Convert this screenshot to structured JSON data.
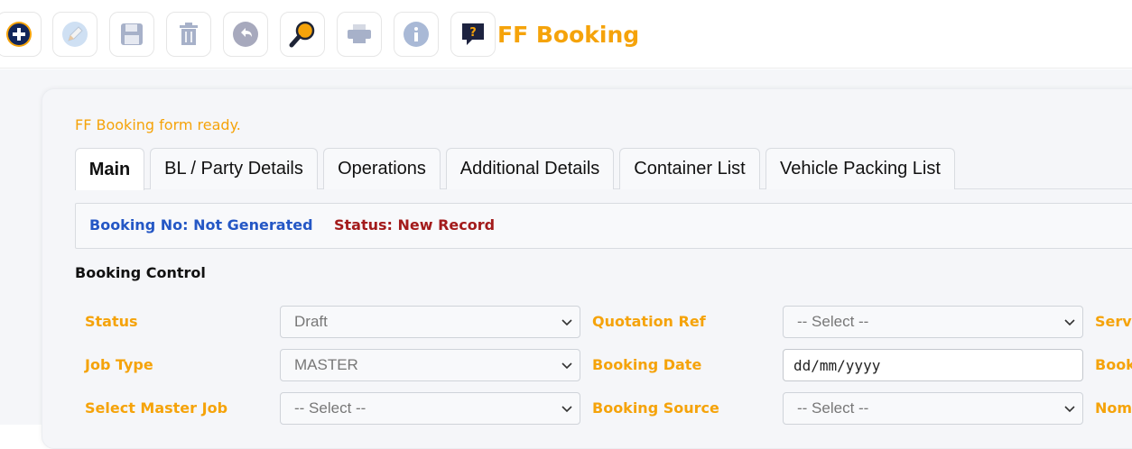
{
  "app": {
    "title": "FF Booking"
  },
  "toolbar": {
    "buttons": [
      {
        "name": "add-button",
        "icon": "plus-circle-icon"
      },
      {
        "name": "edit-button",
        "icon": "pencil-icon"
      },
      {
        "name": "save-button",
        "icon": "floppy-disk-icon"
      },
      {
        "name": "delete-button",
        "icon": "trash-icon"
      },
      {
        "name": "undo-button",
        "icon": "undo-arrow-icon"
      },
      {
        "name": "search-button",
        "icon": "magnifier-icon"
      },
      {
        "name": "print-button",
        "icon": "printer-icon"
      },
      {
        "name": "info-button",
        "icon": "info-icon"
      },
      {
        "name": "help-button",
        "icon": "question-chat-icon"
      }
    ]
  },
  "status_message": "FF Booking form ready.",
  "tabs": [
    {
      "label": "Main",
      "active": true
    },
    {
      "label": "BL / Party Details"
    },
    {
      "label": "Operations"
    },
    {
      "label": "Additional Details"
    },
    {
      "label": "Container List"
    },
    {
      "label": "Vehicle Packing List"
    }
  ],
  "info": {
    "booking_no": "Booking No: Not Generated",
    "status": "Status: New Record"
  },
  "section_title": "Booking Control",
  "form": {
    "status_label": "Status",
    "status_value": "Draft",
    "job_type_label": "Job Type",
    "job_type_value": "MASTER",
    "master_job_label": "Select Master Job",
    "master_job_value": "-- Select --",
    "quotation_label": "Quotation Ref",
    "quotation_value": "-- Select --",
    "booking_date_label": "Booking Date",
    "booking_date_value": "dd/mm/yyyy",
    "booking_source_label": "Booking Source",
    "booking_source_value": "-- Select --",
    "col3_row1_label": "Servi",
    "col3_row2_label": "Book",
    "col3_row3_label": "Nom"
  },
  "colors": {
    "accent": "#f5a30a",
    "booking_no": "#2457c5",
    "status_new": "#a31b1b"
  }
}
